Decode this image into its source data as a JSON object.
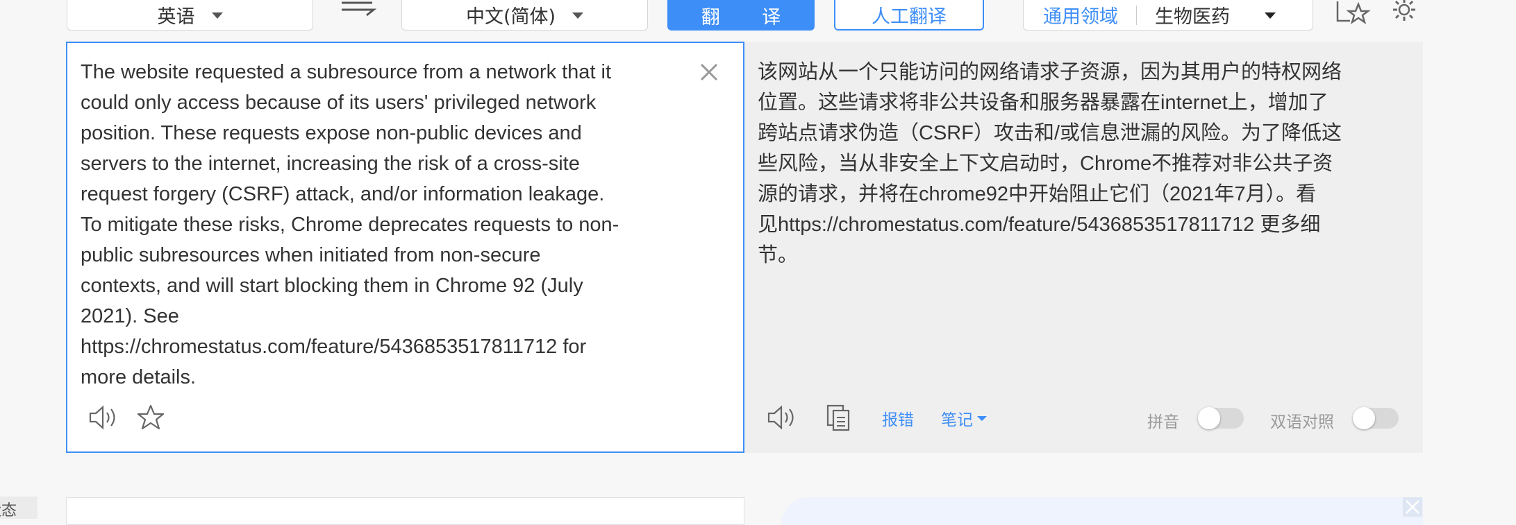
{
  "top_bar": {
    "source_lang": "英语",
    "target_lang": "中文(简体)",
    "translate_button": "翻 译",
    "human_translate_button": "人工翻译",
    "domain_general": "通用领域",
    "domain_selected": "生物医药"
  },
  "source": {
    "text": "The website requested a subresource from a network that it\ncould only access because of its users' privileged network\nposition. These requests expose non-public devices and\nservers to the internet, increasing the risk of a cross-site\nrequest forgery (CSRF) attack, and/or information leakage.\nTo mitigate these risks, Chrome deprecates requests to non-\npublic subresources when initiated from non-secure\ncontexts, and will start blocking them in Chrome 92 (July\n2021). See\nhttps://chromestatus.com/feature/5436853517811712 for\nmore details."
  },
  "target": {
    "text": "该网站从一个只能访问的网络请求子资源，因为其用户的特权网络\n位置。这些请求将非公共设备和服务器暴露在internet上，增加了\n跨站点请求伪造（CSRF）攻击和/或信息泄漏的风险。为了降低这\n些风险，当从非安全上下文启动时，Chrome不推荐对非公共子资\n源的请求，并将在chrome92中开始阻止它们（2021年7月）。看\n见https://chromestatus.com/feature/5436853517811712 更多细\n节。",
    "report_error": "报错",
    "notes": "笔记",
    "pinyin_label": "拼音",
    "pinyin_on": false,
    "bilingual_label": "双语对照",
    "bilingual_on": false
  },
  "left_edge_fragment": "状态",
  "colors": {
    "accent": "#3e8ef7",
    "target_bg": "#efefef",
    "page_bg": "#f7f7f7"
  }
}
